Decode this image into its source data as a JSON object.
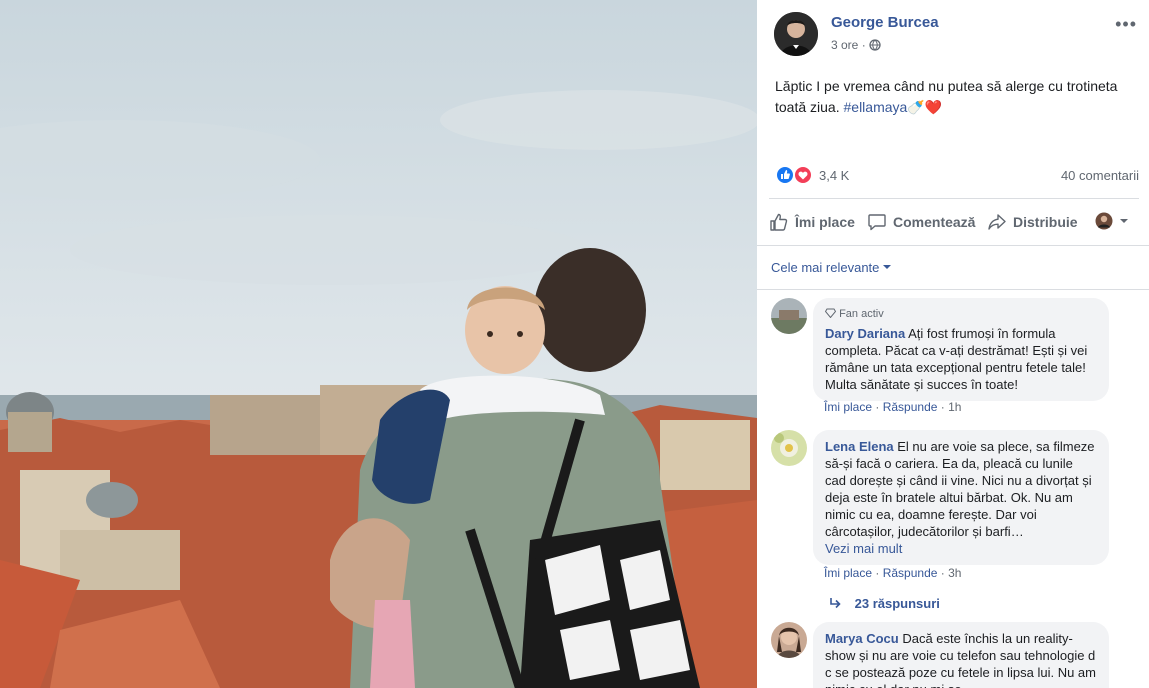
{
  "post": {
    "author": "George Burcea",
    "time": "3 ore",
    "separator": "·",
    "more": "•••",
    "text": "Lăptic I pe vremea când nu putea să alerge cu trotineta toată ziua.",
    "hashtag": "#ellamaya",
    "emoji": "🍼❤️"
  },
  "stats": {
    "reactions_count": "3,4 K",
    "comments_count": "40 comentarii"
  },
  "actions": {
    "like": "Îmi place",
    "comment": "Comentează",
    "share": "Distribuie"
  },
  "sort_label": "Cele mai relevante",
  "comments": [
    {
      "badge": "Fan activ",
      "name": "Dary Dariana",
      "text": "Ați fost frumoși în formula completa. Păcat ca v-ați destrămat! Ești și vei rămâne un tata excepțional pentru fetele tale! Multa sănătate și succes în toate!",
      "like": "Îmi place",
      "reply": "Răspunde",
      "dot": "·",
      "time": "1h"
    },
    {
      "name": "Lena Elena",
      "text": "El nu are voie sa plece, sa filmeze să-și facă o cariera. Ea da, pleacă cu lunile cad dorește și când ii vine. Nici nu a divorțat și deja este în bratele altui bărbat. Ok. Nu am nimic cu ea, doamne ferește. Dar voi cârcotașilor, judecătorilor și barfi…",
      "see_more": "Vezi mai mult",
      "like": "Îmi place",
      "reply": "Răspunde",
      "dot": "·",
      "time": "3h"
    },
    {
      "name": "Marya Cocu",
      "text": "Dacă este închis la un reality-show și nu are voie cu telefon sau tehnologie d c se postează poze cu fetele in lipsa lui. Nu am nimic cu el dar nu mi se"
    }
  ],
  "replies_label": "23 răspunsuri",
  "colors": {
    "link": "#385898",
    "secondary": "#606770",
    "bubble": "#f2f3f5",
    "like_blue": "#1877f2",
    "love_red": "#f33e58"
  }
}
